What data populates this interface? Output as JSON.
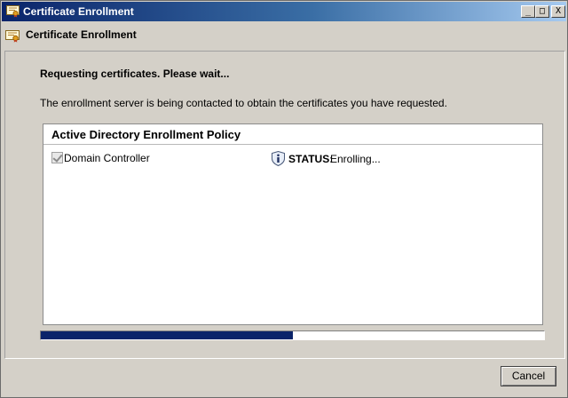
{
  "window": {
    "title": "Certificate Enrollment",
    "buttons": {
      "minimize": "_",
      "maximize": "□",
      "close": "X"
    }
  },
  "header": {
    "title": "Certificate Enrollment",
    "icon": "certificate-icon"
  },
  "main": {
    "heading": "Requesting certificates. Please wait...",
    "description": "The enrollment server is being contacted to obtain the certificates you have requested."
  },
  "policy": {
    "title": "Active Directory Enrollment Policy",
    "items": [
      {
        "name": "Domain Controller",
        "checked": true,
        "status_label": "STATUS:",
        "status_value": "Enrolling...",
        "status_icon": "info-icon"
      }
    ]
  },
  "progress": {
    "value": 0.5
  },
  "footer": {
    "cancel_label": "Cancel"
  },
  "colors": {
    "titlebar_start": "#0a246a",
    "titlebar_end": "#a6caf0",
    "progress_fill": "#0a246a",
    "dialog_bg": "#d4d0c8"
  }
}
